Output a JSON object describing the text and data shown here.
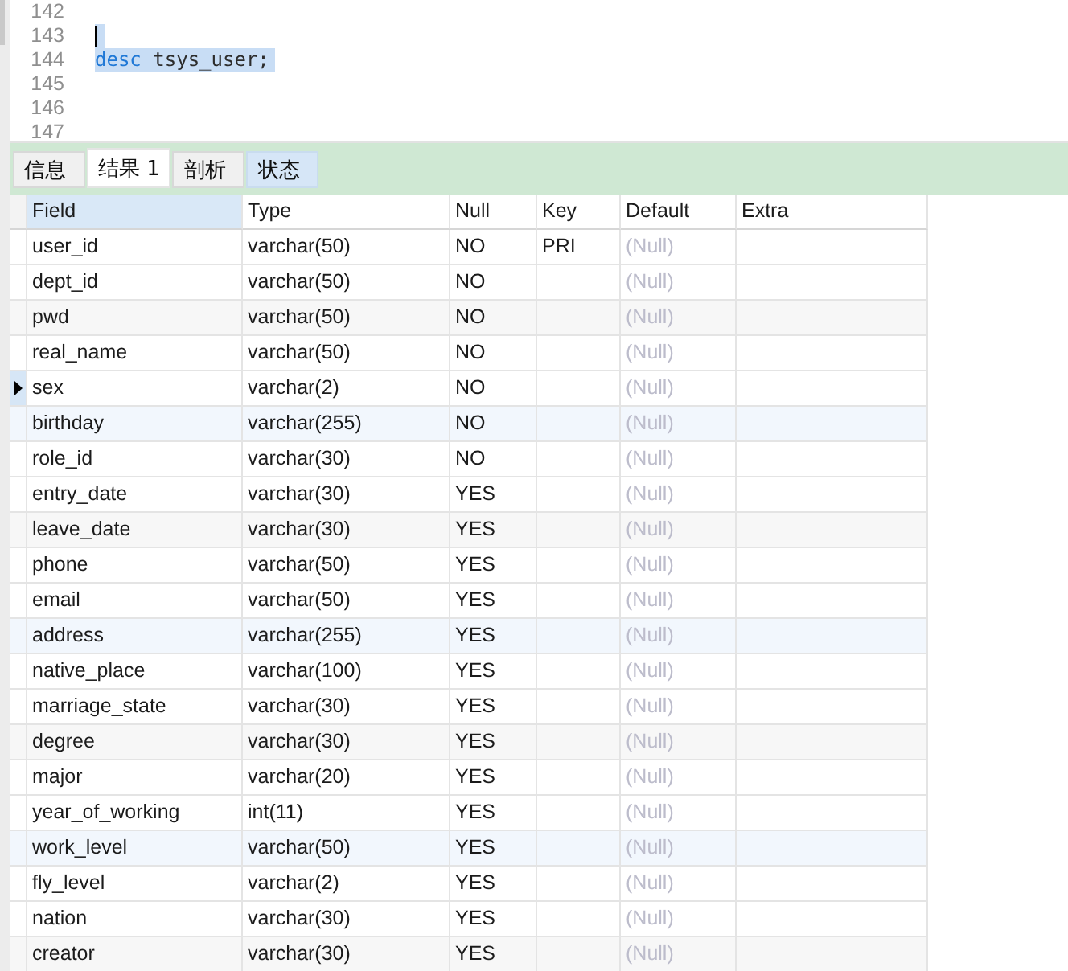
{
  "editor": {
    "lines": [
      {
        "number": "142",
        "selected": false,
        "caret": false
      },
      {
        "number": "143",
        "selected": true,
        "caret": true
      },
      {
        "number": "144",
        "selected": true,
        "caret": false,
        "tokens": [
          {
            "text": "desc",
            "kind": "keyword"
          },
          {
            "text": "tsys_user;",
            "kind": "plain"
          }
        ]
      },
      {
        "number": "145",
        "selected": false,
        "caret": false
      },
      {
        "number": "146",
        "selected": false,
        "caret": false
      },
      {
        "number": "147",
        "selected": false,
        "caret": false
      }
    ]
  },
  "results": {
    "tabs": [
      {
        "label": "信息",
        "selected": false,
        "hovered": false
      },
      {
        "label": "结果 1",
        "selected": true,
        "hovered": false
      },
      {
        "label": "剖析",
        "selected": false,
        "hovered": false
      },
      {
        "label": "状态",
        "selected": false,
        "hovered": true
      }
    ]
  },
  "table": {
    "columns": [
      {
        "label": "Field",
        "selected": true
      },
      {
        "label": "Type",
        "selected": false
      },
      {
        "label": "Null",
        "selected": false
      },
      {
        "label": "Key",
        "selected": false
      },
      {
        "label": "Default",
        "selected": false
      },
      {
        "label": "Extra",
        "selected": false
      }
    ],
    "rows": [
      {
        "field": "user_id",
        "type": "varchar(50)",
        "null": "NO",
        "key": "PRI",
        "default": "(Null)",
        "default_is_null": true,
        "current": false
      },
      {
        "field": "dept_id",
        "type": "varchar(50)",
        "null": "NO",
        "default": "(Null)",
        "default_is_null": true,
        "current": false
      },
      {
        "field": "pwd",
        "type": "varchar(50)",
        "null": "NO",
        "default": "(Null)",
        "default_is_null": true,
        "current": false
      },
      {
        "field": "real_name",
        "type": "varchar(50)",
        "null": "NO",
        "default": "(Null)",
        "default_is_null": true,
        "current": false
      },
      {
        "field": "sex",
        "type": "varchar(2)",
        "null": "NO",
        "default": "(Null)",
        "default_is_null": true,
        "current": true
      },
      {
        "field": "birthday",
        "type": "varchar(255)",
        "null": "NO",
        "default": "(Null)",
        "default_is_null": true,
        "current": false
      },
      {
        "field": "role_id",
        "type": "varchar(30)",
        "null": "NO",
        "default": "(Null)",
        "default_is_null": true,
        "current": false
      },
      {
        "field": "entry_date",
        "type": "varchar(30)",
        "null": "YES",
        "default": "(Null)",
        "default_is_null": true,
        "current": false
      },
      {
        "field": "leave_date",
        "type": "varchar(30)",
        "null": "YES",
        "default": "(Null)",
        "default_is_null": true,
        "current": false
      },
      {
        "field": "phone",
        "type": "varchar(50)",
        "null": "YES",
        "default": "(Null)",
        "default_is_null": true,
        "current": false
      },
      {
        "field": "email",
        "type": "varchar(50)",
        "null": "YES",
        "default": "(Null)",
        "default_is_null": true,
        "current": false
      },
      {
        "field": "address",
        "type": "varchar(255)",
        "null": "YES",
        "default": "(Null)",
        "default_is_null": true,
        "current": false
      },
      {
        "field": "native_place",
        "type": "varchar(100)",
        "null": "YES",
        "default": "(Null)",
        "default_is_null": true,
        "current": false
      },
      {
        "field": "marriage_state",
        "type": "varchar(30)",
        "null": "YES",
        "default": "(Null)",
        "default_is_null": true,
        "current": false
      },
      {
        "field": "degree",
        "type": "varchar(30)",
        "null": "YES",
        "default": "(Null)",
        "default_is_null": true,
        "current": false
      },
      {
        "field": "major",
        "type": "varchar(20)",
        "null": "YES",
        "default": "(Null)",
        "default_is_null": true,
        "current": false
      },
      {
        "field": "year_of_working",
        "type": "int(11)",
        "null": "YES",
        "default": "(Null)",
        "default_is_null": true,
        "current": false
      },
      {
        "field": "work_level",
        "type": "varchar(50)",
        "null": "YES",
        "default": "(Null)",
        "default_is_null": true,
        "current": false
      },
      {
        "field": "fly_level",
        "type": "varchar(2)",
        "null": "YES",
        "default": "(Null)",
        "default_is_null": true,
        "current": false
      },
      {
        "field": "nation",
        "type": "varchar(30)",
        "null": "YES",
        "default": "(Null)",
        "default_is_null": true,
        "current": false
      },
      {
        "field": "creator",
        "type": "varchar(30)",
        "null": "YES",
        "default": "(Null)",
        "default_is_null": true,
        "current": false
      }
    ]
  }
}
